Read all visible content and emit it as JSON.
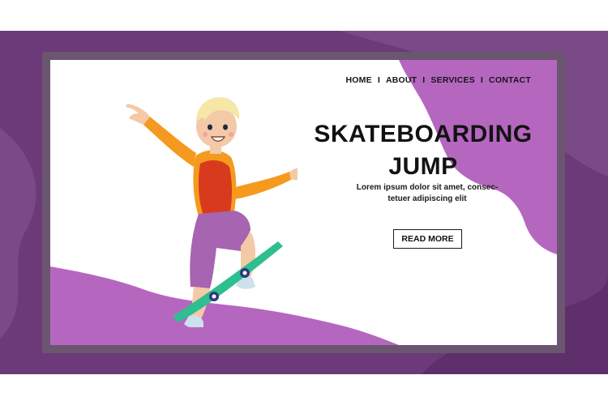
{
  "nav": {
    "items": [
      {
        "label": "HOME"
      },
      {
        "label": "ABOUT"
      },
      {
        "label": "SERVICES"
      },
      {
        "label": "CONTACT"
      }
    ],
    "separator": "I"
  },
  "hero": {
    "title_line1": "SKATEBOARDING",
    "title_line2": "JUMP",
    "subtitle_line1": "Lorem ipsum dolor sit amet, consec-",
    "subtitle_line2": "tetuer adipiscing elit",
    "cta_label": "READ MORE"
  },
  "illustration": {
    "subject": "boy-on-skateboard",
    "icon": "skateboard-icon"
  },
  "colors": {
    "band_purple": "#6c3a78",
    "frame_gray": "#6b5570",
    "accent_violet": "#b567c0",
    "card_white": "#ffffff",
    "text_dark": "#121212"
  }
}
